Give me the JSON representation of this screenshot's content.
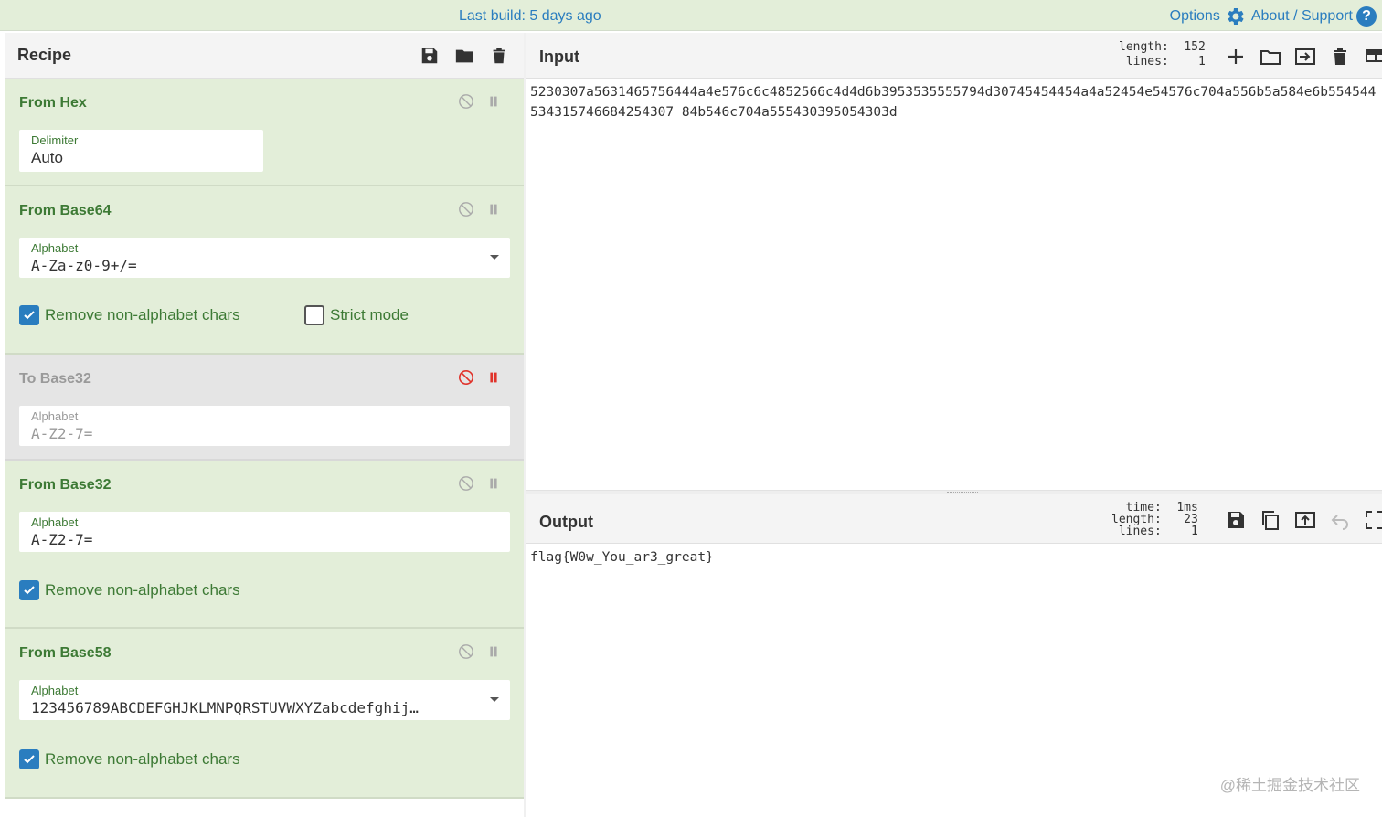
{
  "topbar": {
    "build_label": "Last build: 5 days ago",
    "options_label": "Options",
    "about_label": "About / Support"
  },
  "recipe": {
    "title": "Recipe",
    "operations": [
      {
        "title": "From Hex",
        "field_label": "Delimiter",
        "field_value": "Auto"
      },
      {
        "title": "From Base64",
        "field_label": "Alphabet",
        "field_value": "A-Za-z0-9+/=",
        "check1": "Remove non-alphabet chars",
        "check2": "Strict mode"
      },
      {
        "title": "To Base32",
        "field_label": "Alphabet",
        "field_value": "A-Z2-7="
      },
      {
        "title": "From Base32",
        "field_label": "Alphabet",
        "field_value": "A-Z2-7=",
        "check1": "Remove non-alphabet chars"
      },
      {
        "title": "From Base58",
        "field_label": "Alphabet",
        "field_value": "123456789ABCDEFGHJKLMNPQRSTUVWXYZabcdefghij…",
        "check1": "Remove non-alphabet chars"
      }
    ]
  },
  "input": {
    "title": "Input",
    "length_key": "length:",
    "length_val": "152",
    "lines_key": "lines:",
    "lines_val": "1",
    "text": "5230307a5631465756444a4e576c6c4852566c4d4d6b3953535555794d30745454454a4a52454e54576c704a556b5a584e6b554544534315746684254307 84b546c704a555430395054303d"
  },
  "output": {
    "title": "Output",
    "time_key": "time:",
    "time_val": "1ms",
    "length_key": "length:",
    "length_val": "23",
    "lines_key": "lines:",
    "lines_val": "1",
    "text": "flag{W0w_You_ar3_great}"
  },
  "watermark": "@稀土掘金技术社区",
  "colors": {
    "accent": "#2a7dbf",
    "op_bg": "#e3eed9",
    "op_text": "#3d7a35",
    "disabled_red": "#e0322a"
  }
}
